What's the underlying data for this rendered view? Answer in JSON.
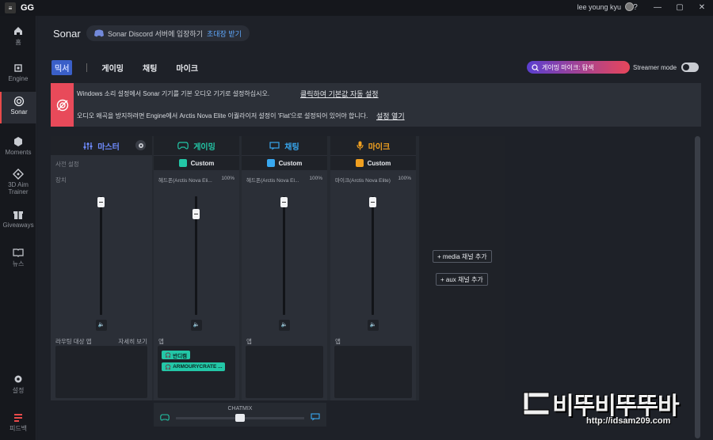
{
  "titlebar": {
    "logo": "GG",
    "user": "lee young kyu",
    "controls": [
      "?",
      "—",
      "▢",
      "✕"
    ]
  },
  "sidebar": {
    "items": [
      {
        "label": "홈"
      },
      {
        "label": "Engine"
      },
      {
        "label": "Sonar"
      },
      {
        "label": "Moments"
      },
      {
        "label": "3D Aim Trainer"
      },
      {
        "label": "Giveaways"
      },
      {
        "label": "뉴스"
      },
      {
        "label": "설정"
      },
      {
        "label": "피드백"
      }
    ]
  },
  "header": {
    "title": "Sonar",
    "discord_text": "Sonar Discord 서버에 입장하기",
    "discord_link": "초대장 받기"
  },
  "tabs": [
    "믹서",
    "게이밍",
    "채팅",
    "마이크"
  ],
  "game_mic_pill": "게이밍 마이크: 탐색",
  "streamer_mode": "Streamer mode",
  "alert": {
    "line1": "Windows 소리 설정에서 Sonar 기기를 기본 오디오 기기로 설정하십시오.",
    "link1": "클릭하여 기본값 자동 설정",
    "line2": "오디오 왜곡을 방지하려면 Engine에서 Arctis Nova Elite 이퀄라이저 설정이 'Flat'으로 설정되어 있어야 합니다.",
    "link2": "설정 열기"
  },
  "columns": [
    {
      "title": "마스터",
      "color": "#6f8cff",
      "preset_label": "사전 설정",
      "device_label": "장치",
      "app_label": "라우팅 대상 앱",
      "detail": "자세히 보기",
      "level": 0.97
    },
    {
      "title": "게이밍",
      "color": "#23c7a7",
      "preset": "Custom",
      "device": "헤드폰(Arctis Nova Eli...",
      "pct": "100%",
      "app_label": "앱",
      "level": 0.87,
      "apps": [
        "반디캠",
        "ARMOURYCRATE ..."
      ]
    },
    {
      "title": "채팅",
      "color": "#38a8f0",
      "preset": "Custom",
      "device": "헤드폰(Arctis Nova El...",
      "pct": "100%",
      "app_label": "앱",
      "level": 0.97
    },
    {
      "title": "마이크",
      "color": "#f0a020",
      "preset": "Custom",
      "device": "마이크(Arctis Nova Elite)",
      "pct": "100%",
      "app_label": "앱",
      "level": 0.97
    }
  ],
  "add_buttons": [
    "+ media 채널 추가",
    "+ aux 채널 추가"
  ],
  "chatmix": {
    "label": "CHATMIX",
    "level": 0.5
  },
  "watermark": {
    "big": "비뚜비뚜뚜바",
    "small": "http://idsam209.com"
  },
  "colors": {
    "accent_red": "#e84a5a",
    "teal": "#23c7a7",
    "blue": "#6f8cff"
  }
}
